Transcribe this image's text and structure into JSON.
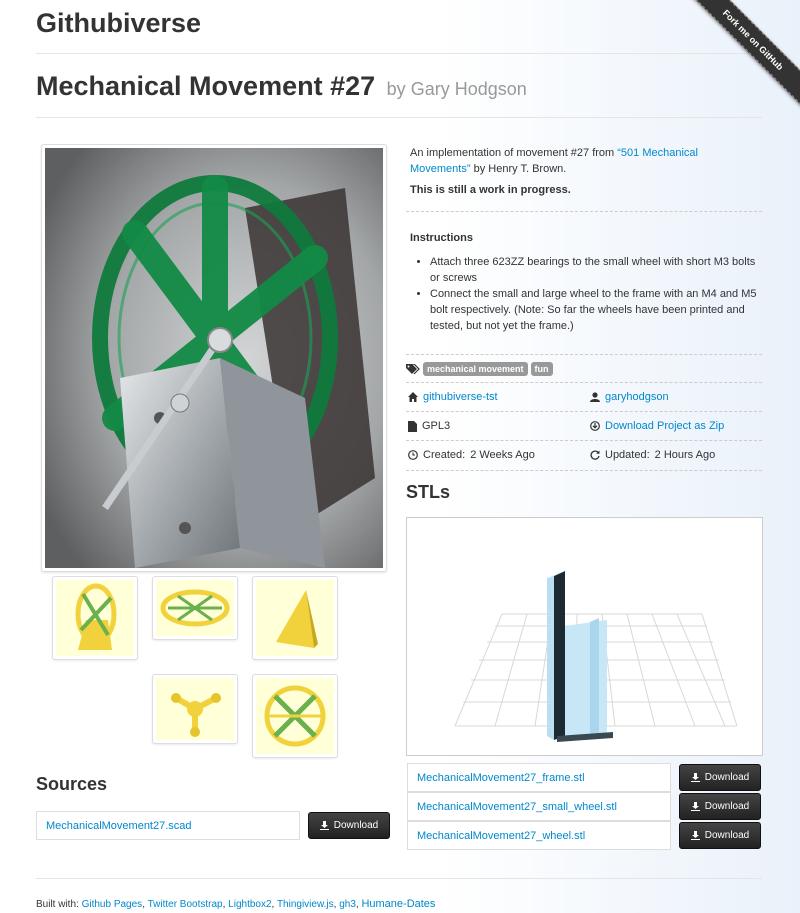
{
  "site": {
    "title": "Githubiverse"
  },
  "ribbon": {
    "label": "Fork me on GitHub"
  },
  "project": {
    "title": "Mechanical Movement #27",
    "by_prefix": "by",
    "author": "Gary Hodgson",
    "description_before": "An implementation of movement #27 from ",
    "description_link": "“501 Mechanical Movements”",
    "description_after": " by Henry T. Brown.",
    "status": "This is still a work in progress.",
    "instructions_heading": "Instructions",
    "instructions": [
      "Attach three 623ZZ bearings to the small wheel with short M3 bolts or screws",
      "Connect the small and large wheel to the frame with an M4 and M5 bolt respectively. (Note: So far the wheels have been printed and tested, but not yet the frame.)"
    ],
    "tags": [
      "mechanical movement",
      "fun"
    ],
    "repo": "githubiverse-tst",
    "user": "garyhodgson",
    "license": "GPL3",
    "download_zip": "Download Project as Zip",
    "created_label": "Created:",
    "created_value": "2 Weeks Ago",
    "updated_label": "Updated:",
    "updated_value": "2 Hours Ago"
  },
  "icons": {
    "tags": "tags-icon",
    "home": "home-icon",
    "user": "user-icon",
    "file": "file-icon",
    "download": "download-circle-icon",
    "clock": "clock-icon",
    "refresh": "refresh-icon"
  },
  "stls": {
    "heading": "STLs",
    "files": [
      {
        "name": "MechanicalMovement27_frame.stl",
        "button": "Download"
      },
      {
        "name": "MechanicalMovement27_small_wheel.stl",
        "button": "Download"
      },
      {
        "name": "MechanicalMovement27_wheel.stl",
        "button": "Download"
      }
    ]
  },
  "sources": {
    "heading": "Sources",
    "files": [
      {
        "name": "MechanicalMovement27.scad",
        "button": "Download"
      }
    ]
  },
  "footer": {
    "prefix": "Built with:",
    "links": [
      "Github Pages",
      "Twitter Bootstrap",
      "Lightbox2",
      "Thingiview.js",
      "gh3",
      "Humane-Dates"
    ]
  },
  "colors": {
    "link": "#0088cc",
    "tag_bg": "#999999",
    "button_bg": "#222222",
    "thumb_bg": "#ffffd8",
    "wheel_green": "#0f7a3c",
    "part_yellow": "#f2d23c"
  }
}
